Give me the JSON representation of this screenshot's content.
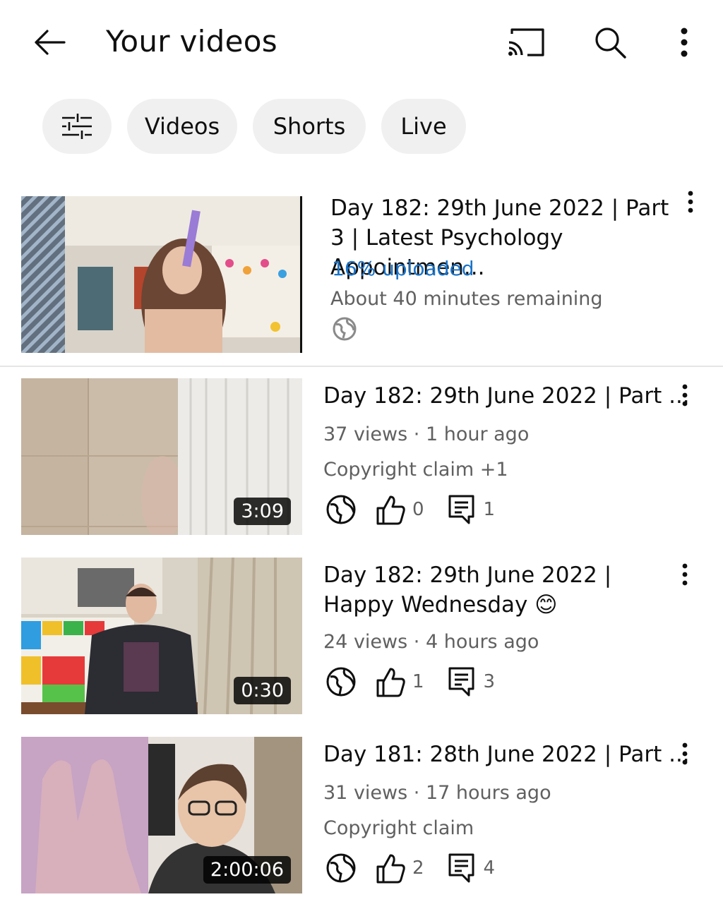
{
  "header": {
    "title": "Your videos",
    "back_icon": "arrow-left-icon",
    "cast_icon": "cast-icon",
    "search_icon": "search-icon",
    "more_icon": "more-vertical-icon"
  },
  "filters": {
    "filter_icon": "sliders-icon",
    "chips": [
      "Videos",
      "Shorts",
      "Live"
    ]
  },
  "uploading": {
    "title": "Day 182: 29th June 2022 | Part 3 | Latest Psychology Appointmen...",
    "status": "16% uploaded",
    "remaining": "About 40 minutes remaining",
    "visibility_icon": "globe-icon"
  },
  "videos": [
    {
      "title": "Day 182: 29th June 2022 | Part ...",
      "views": "37 views",
      "age": "1 hour ago",
      "claim": "Copyright claim +1",
      "duration": "3:09",
      "likes": "0",
      "comments": "1"
    },
    {
      "title": "Day 182: 29th June 2022 | Happy Wednesday 😊",
      "views": "24 views",
      "age": "4 hours ago",
      "claim": "",
      "duration": "0:30",
      "likes": "1",
      "comments": "3"
    },
    {
      "title": "Day 181: 28th June 2022 | Part ...",
      "views": "31 views",
      "age": "17 hours ago",
      "claim": "Copyright claim",
      "duration": "2:00:06",
      "likes": "2",
      "comments": "4"
    }
  ],
  "colors": {
    "upload_blue": "#1a73c8",
    "chip_bg": "#f0f0f0",
    "meta_gray": "#606060"
  }
}
